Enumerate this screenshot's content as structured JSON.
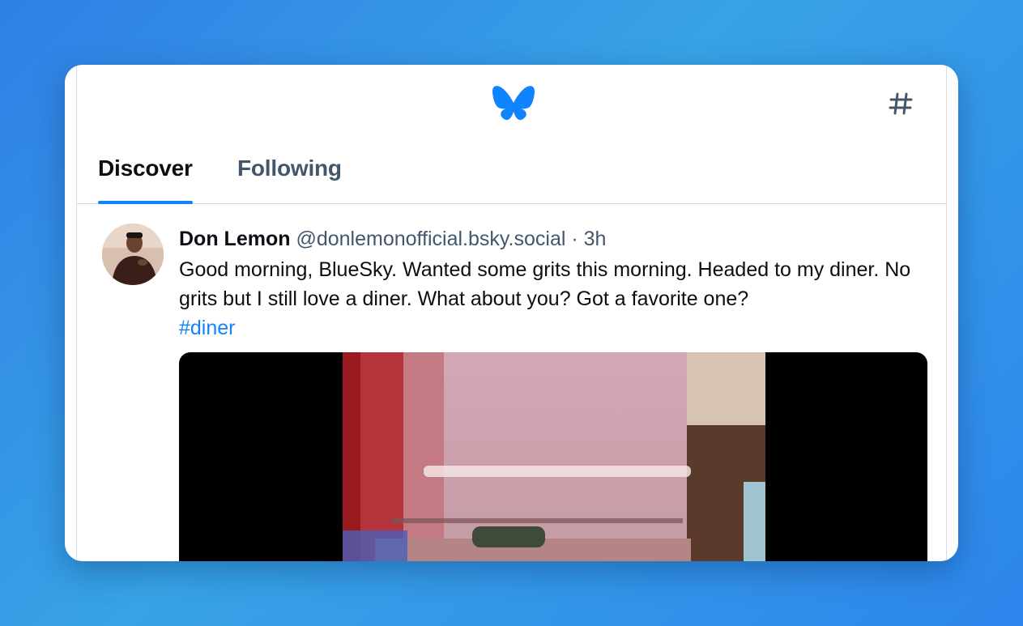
{
  "app": {
    "name": "Bluesky",
    "accent_color": "#1083fe"
  },
  "header": {
    "logo_icon": "butterfly-icon",
    "feeds_icon": "hashtag-icon"
  },
  "tabs": [
    {
      "label": "Discover",
      "active": true
    },
    {
      "label": "Following",
      "active": false
    }
  ],
  "post": {
    "author": "Don Lemon",
    "handle": "@donlemonofficial.bsky.social",
    "separator": "·",
    "time": "3h",
    "text": "Good morning, BlueSky. Wanted some grits this morning. Headed to my diner. No grits but I still love a diner. What about you? Got a favorite one?",
    "hashtag": "#diner",
    "media_type": "video"
  }
}
